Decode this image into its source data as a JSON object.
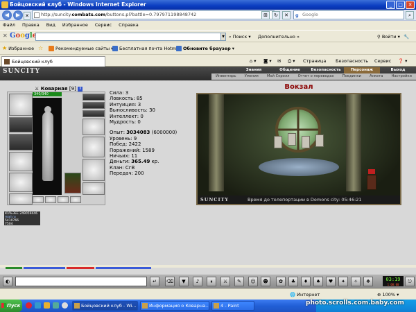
{
  "window": {
    "title": "Бойцовский клуб - Windows Internet Explorer"
  },
  "address": {
    "prefix": "http://suncity.",
    "domain": "combats.com",
    "suffix": "/buttons.pl?battle=0.797971198848742"
  },
  "search": {
    "placeholder": "Google"
  },
  "menu": [
    "Файл",
    "Правка",
    "Вид",
    "Избранное",
    "Сервис",
    "Справка"
  ],
  "google_toolbar": {
    "logo": "Google",
    "search_label": "Поиск",
    "more_label": "Дополнительно",
    "signin_label": "Войти"
  },
  "favorites": {
    "label": "Избранное",
    "items": [
      "Рекомендуемые сайты",
      "Бесплатная почта Hotmail",
      "Обновите браузер"
    ]
  },
  "tab": {
    "label": "Бойцовский клуб"
  },
  "commandbar": {
    "page": "Страница",
    "security": "Безопасность",
    "service": "Сервис"
  },
  "game": {
    "logo": "SUNCITY",
    "nav_top": [
      "Знания",
      "Общение",
      "Безопасность",
      "Персонаж",
      "Выход"
    ],
    "nav_sub": [
      "Инвентарь",
      "Умения",
      "Мой Скролл",
      "Отчет о переводах",
      "Поединки",
      "Анкета",
      "Настройки"
    ]
  },
  "character": {
    "name": "Коварная",
    "level": "[9]",
    "info_icon": "i",
    "hp": "340/340",
    "rating_lines": [
      "ЮЛЬЗЕЕ 249059446",
      "5410766",
      "7504"
    ],
    "rating_label": "mail.ru"
  },
  "stats": {
    "strength": "Сила: 3",
    "agility": "Ловкость: 85",
    "intuition": "Интуиция: 3",
    "endurance": "Выносливость: 30",
    "intellect": "Интеллект: 0",
    "wisdom": "Мудрость: 0",
    "exp_label": "Опыт: ",
    "exp_value": "3034083",
    "exp_next": " (6000000)",
    "level_line": "Уровень: 9",
    "wins": "Побед: 2422",
    "losses": "Поражений: 1589",
    "draws": "Ничьих: 11",
    "money_label": "Деньги: ",
    "money_value": "365.49",
    "money_unit": " кр.",
    "clan": "Клан: СгВ",
    "transfers": "Передач: 200"
  },
  "location": {
    "title": "Вокзал",
    "bar_logo": "SUNCITY",
    "bar_text": "Время до телепортации в Demons city: 05:46:21"
  },
  "gamebar": {
    "clock_time": "03:19",
    "clock_sub": "1:00:00"
  },
  "statusbar": {
    "zone": "Интернет",
    "zoom": "100%"
  },
  "taskbar": {
    "start": "Пуск",
    "items": [
      "Бойцовский клуб - Wi...",
      "Информация о Коварна...",
      "4 - Paint"
    ]
  },
  "watermark": "photo.scrolls.com.baby.com"
}
